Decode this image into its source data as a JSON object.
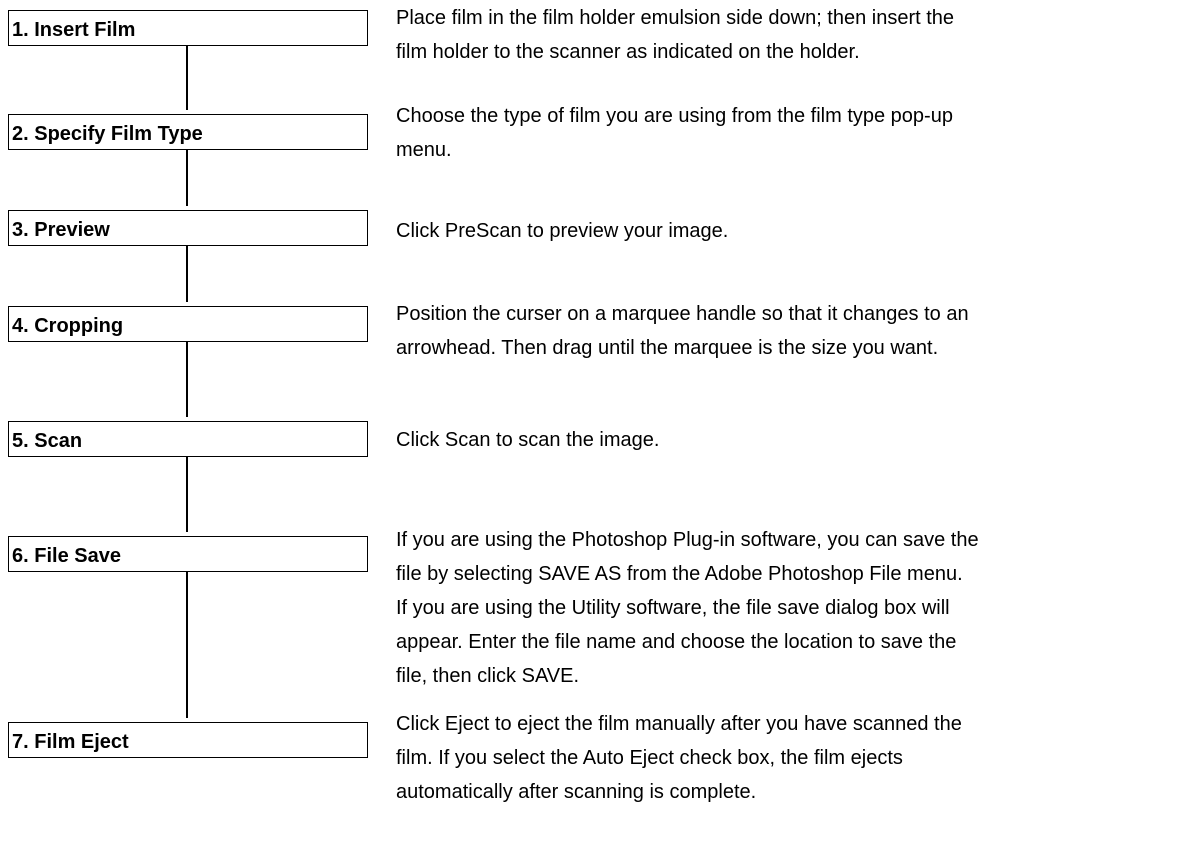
{
  "steps": [
    {
      "label": "1. Insert Film",
      "lines": [
        "Place film in the film holder emulsion side down; then insert the",
        "film holder to the scanner as indicated on the holder."
      ]
    },
    {
      "label": "2. Specify Film Type",
      "lines": [
        "Choose the type of film you are using from the film type pop-up",
        "menu."
      ]
    },
    {
      "label": "3. Preview",
      "lines": [
        "Click PreScan to preview your image."
      ]
    },
    {
      "label": "4. Cropping",
      "lines": [
        "Position the curser on a marquee handle so that it changes to an",
        "arrowhead. Then drag until the marquee is the size you want."
      ]
    },
    {
      "label": "5. Scan",
      "lines": [
        "Click Scan to scan the image."
      ]
    },
    {
      "label": "6. File Save",
      "lines": [
        "If you are using the Photoshop Plug-in software, you can save the",
        "file by selecting SAVE AS from the Adobe Photoshop File menu.",
        "If you are using the Utility software, the file save dialog box will",
        "appear. Enter the file name and choose the location to save the",
        "file, then click SAVE."
      ]
    },
    {
      "label": "7. Film Eject",
      "lines": [
        "Click Eject to eject the film manually after you have scanned the",
        "film. If you select the Auto Eject check box, the film ejects",
        "automatically after scanning is complete."
      ]
    }
  ]
}
